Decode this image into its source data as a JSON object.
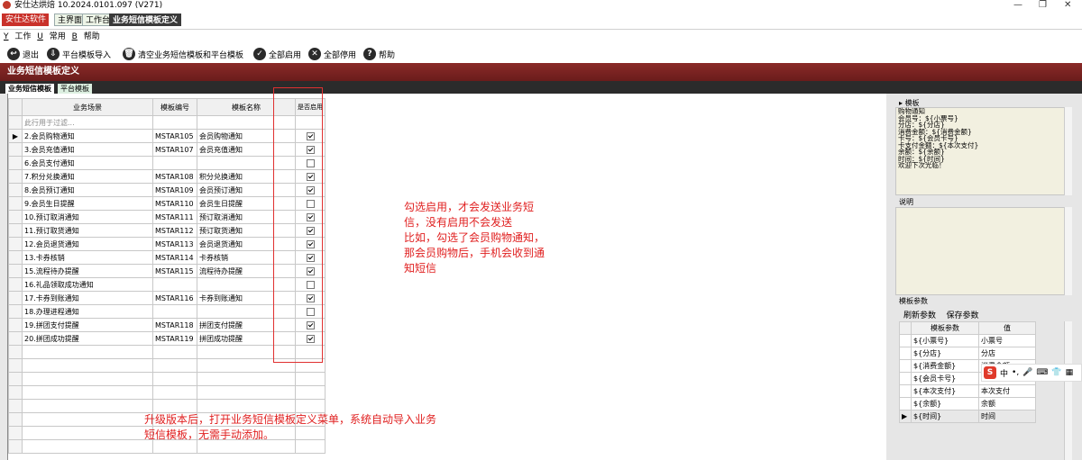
{
  "window": {
    "title": "安仕达烘焙  10.2024.0101.097 (V271)",
    "controls": [
      "—",
      "❐",
      "✕"
    ]
  },
  "app_menu": "安仕达软件",
  "window_tabs": [
    "主界面",
    "工作台",
    "业务短信模板定义"
  ],
  "menu": [
    "工作",
    "常用",
    "帮助"
  ],
  "toolbar": {
    "exit": "退出",
    "import": "平台模板导入",
    "clear": "清空业务短信模板和平台模板",
    "enable_all": "全部启用",
    "disable_all": "全部停用",
    "help": "帮助"
  },
  "banner": "业务短信模板定义",
  "sub_tabs": [
    "业务短信模板",
    "平台模板"
  ],
  "grid": {
    "headers": [
      "业务场景",
      "模板编号",
      "模板名称",
      "是否启用"
    ],
    "filter_placeholder": "此行用于过滤...",
    "rows": [
      {
        "scene": "2.会员购物通知",
        "code": "MSTAR105",
        "name": "会员购物通知",
        "enabled": true
      },
      {
        "scene": "3.会员充值通知",
        "code": "MSTAR107",
        "name": "会员充值通知",
        "enabled": true
      },
      {
        "scene": "6.会员支付通知",
        "code": "",
        "name": "",
        "enabled": false
      },
      {
        "scene": "7.积分兑换通知",
        "code": "MSTAR108",
        "name": "积分兑换通知",
        "enabled": true
      },
      {
        "scene": "8.会员预订通知",
        "code": "MSTAR109",
        "name": "会员预订通知",
        "enabled": true
      },
      {
        "scene": "9.会员生日提醒",
        "code": "MSTAR110",
        "name": "会员生日提醒",
        "enabled": false
      },
      {
        "scene": "10.预订取消通知",
        "code": "MSTAR111",
        "name": "预订取消通知",
        "enabled": true
      },
      {
        "scene": "11.预订取货通知",
        "code": "MSTAR112",
        "name": "预订取货通知",
        "enabled": true
      },
      {
        "scene": "12.会员退货通知",
        "code": "MSTAR113",
        "name": "会员退货通知",
        "enabled": true
      },
      {
        "scene": "13.卡券核销",
        "code": "MSTAR114",
        "name": "卡券核销",
        "enabled": true
      },
      {
        "scene": "15.流程待办提醒",
        "code": "MSTAR115",
        "name": "流程待办提醒",
        "enabled": true
      },
      {
        "scene": "16.礼品领取成功通知",
        "code": "",
        "name": "",
        "enabled": false
      },
      {
        "scene": "17.卡券到账通知",
        "code": "MSTAR116",
        "name": "卡券到账通知",
        "enabled": true
      },
      {
        "scene": "18.办理进程通知",
        "code": "",
        "name": "",
        "enabled": false
      },
      {
        "scene": "19.拼团支付提醒",
        "code": "MSTAR118",
        "name": "拼团支付提醒",
        "enabled": true
      },
      {
        "scene": "20.拼团成功提醒",
        "code": "MSTAR119",
        "name": "拼团成功提醒",
        "enabled": true
      }
    ]
  },
  "annotations": {
    "enable_note": [
      "勾选启用，才会发送业务短",
      "信，没有启用不会发送",
      "比如，勾选了会员购物通知，",
      "那会员购物后，手机会收到通",
      "知短信"
    ],
    "upgrade_note": [
      "升级版本后，打开业务短信模板定义菜单，系统自动导入业务",
      "短信模板，无需手动添加。"
    ]
  },
  "right_panel": {
    "template_label": "模板",
    "template_lines": [
      "购物通知",
      "会员号：${小票号}",
      "分店：${分店}",
      "消费金额：${消费金额}",
      "卡号：${会员卡号}",
      "卡支付金额：${本次支付}",
      "余额：${余额}",
      "时间：${时间}",
      "欢迎下次光临！"
    ],
    "desc_label": "说明",
    "params_label": "模板参数",
    "refresh_btn": "刷新参数",
    "save_btn": "保存参数",
    "param_headers": [
      "模板参数",
      "值"
    ],
    "params": [
      {
        "name": "${小票号}",
        "value": "小票号"
      },
      {
        "name": "${分店}",
        "value": "分店"
      },
      {
        "name": "${消费金额}",
        "value": "消费金额"
      },
      {
        "name": "${会员卡号}",
        "value": "会员卡号"
      },
      {
        "name": "${本次支付}",
        "value": "本次支付"
      },
      {
        "name": "${余额}",
        "value": "余额"
      },
      {
        "name": "${时间}",
        "value": "时间"
      }
    ]
  },
  "ime": {
    "logo": "S",
    "lang": "中"
  }
}
